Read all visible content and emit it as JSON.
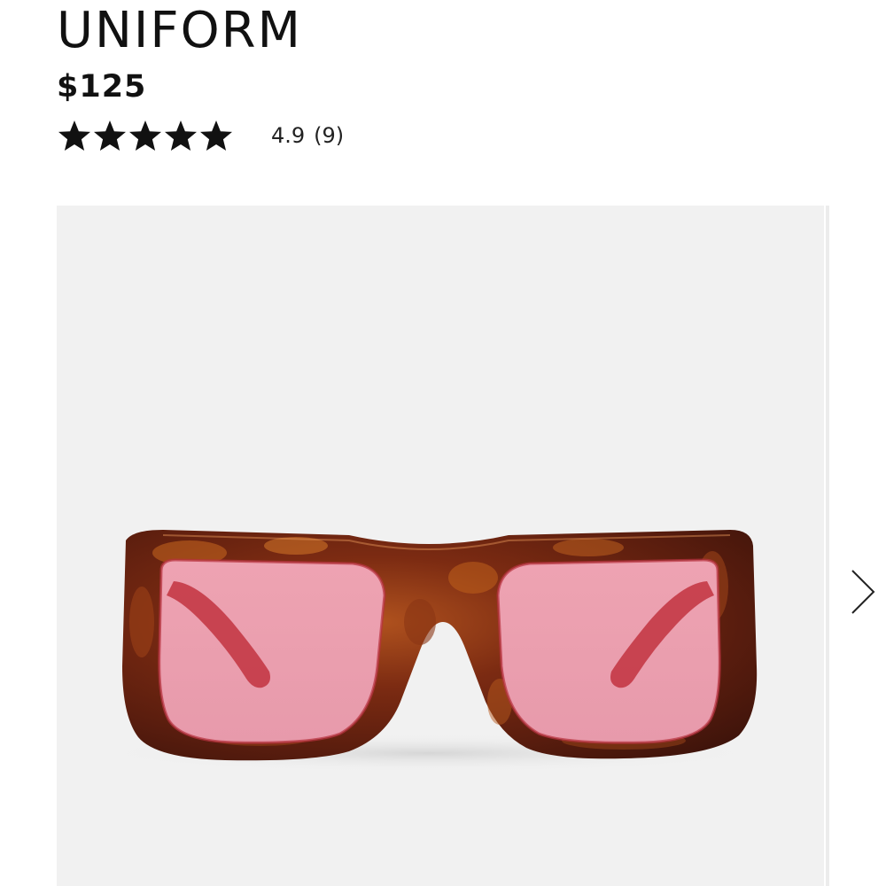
{
  "product": {
    "name": "UNIFORM",
    "price": "$125",
    "rating": {
      "value": "4.9",
      "count": "(9)",
      "stars_filled": 5,
      "stars_total": 5
    }
  },
  "gallery": {
    "background_color": "#f1f1f1",
    "frame_color": "tortoiseshell",
    "lens_color": "#e8a2b0",
    "next_icon": "chevron-right-icon"
  }
}
